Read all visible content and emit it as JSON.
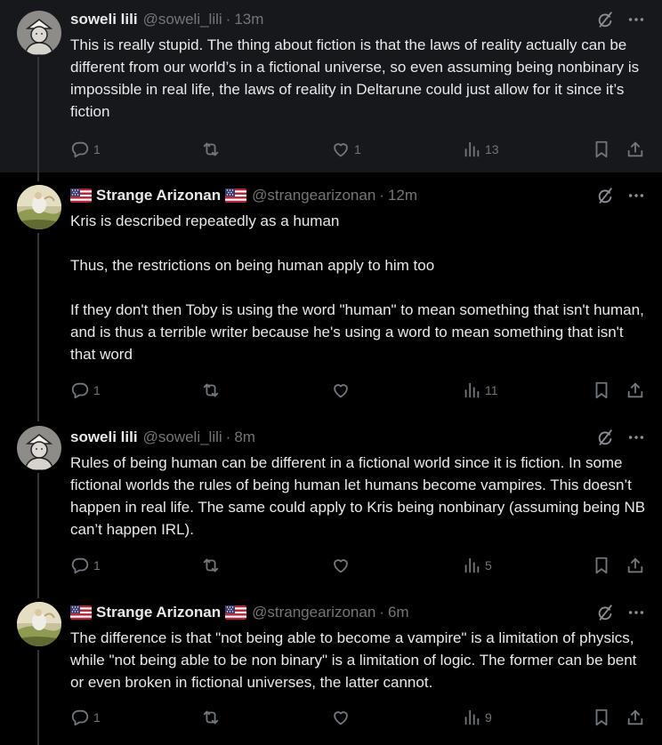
{
  "tweets": [
    {
      "name": "soweli lili",
      "flag_left": "",
      "flag_right": "",
      "handle": "@soweli_lili",
      "separator": "·",
      "time": "13m",
      "text": "This is really stupid. The thing about fiction is that the laws of reality actually can be different from our world’s in a fictional universe, so even assuming being nonbinary is impossible in real life, the laws of reality in Deltarune could just allow for it since it’s fiction",
      "replies": "1",
      "reposts": "",
      "likes": "1",
      "views": "13",
      "avatar_icon": "sketch-avatar-icon"
    },
    {
      "name": "Strange Arizonan",
      "flag_left": "us-flag-icon",
      "flag_right": "us-flag-icon",
      "handle": "@strangearizonan",
      "separator": "·",
      "time": "12m",
      "text": "Kris is described repeatedly as a human\n\nThus, the restrictions on being human apply to him too\n\nIf they don't then Toby is using the word \"human\" to mean something that isn't human, and is thus a terrible writer because he's using a word to mean something that isn't that word",
      "replies": "1",
      "reposts": "",
      "likes": "",
      "views": "11",
      "avatar_icon": "painting-avatar-icon"
    },
    {
      "name": "soweli lili",
      "flag_left": "",
      "flag_right": "",
      "handle": "@soweli_lili",
      "separator": "·",
      "time": "8m",
      "text": "Rules of being human can be different in a fictional world since it is fiction. In some fictional worlds the rules of being human let humans become vampires. This doesn’t happen in real life. The same could apply to Kris being nonbinary (assuming being NB can’t happen IRL).",
      "replies": "1",
      "reposts": "",
      "likes": "",
      "views": "5",
      "avatar_icon": "sketch-avatar-icon"
    },
    {
      "name": "Strange Arizonan",
      "flag_left": "us-flag-icon",
      "flag_right": "us-flag-icon",
      "handle": "@strangearizonan",
      "separator": "·",
      "time": "6m",
      "text": "The difference is that \"not being able to become a vampire\" is a limitation of physics, while \"not being able to be non binary\" is a limitation of logic. The former can be bent or even broken in fictional universes, the latter cannot.",
      "replies": "1",
      "reposts": "",
      "likes": "",
      "views": "9",
      "avatar_icon": "painting-avatar-icon"
    }
  ],
  "colors": {
    "text": "#e7e9ea",
    "muted": "#71767b",
    "background": "#000000",
    "highlight": "#16181c"
  }
}
